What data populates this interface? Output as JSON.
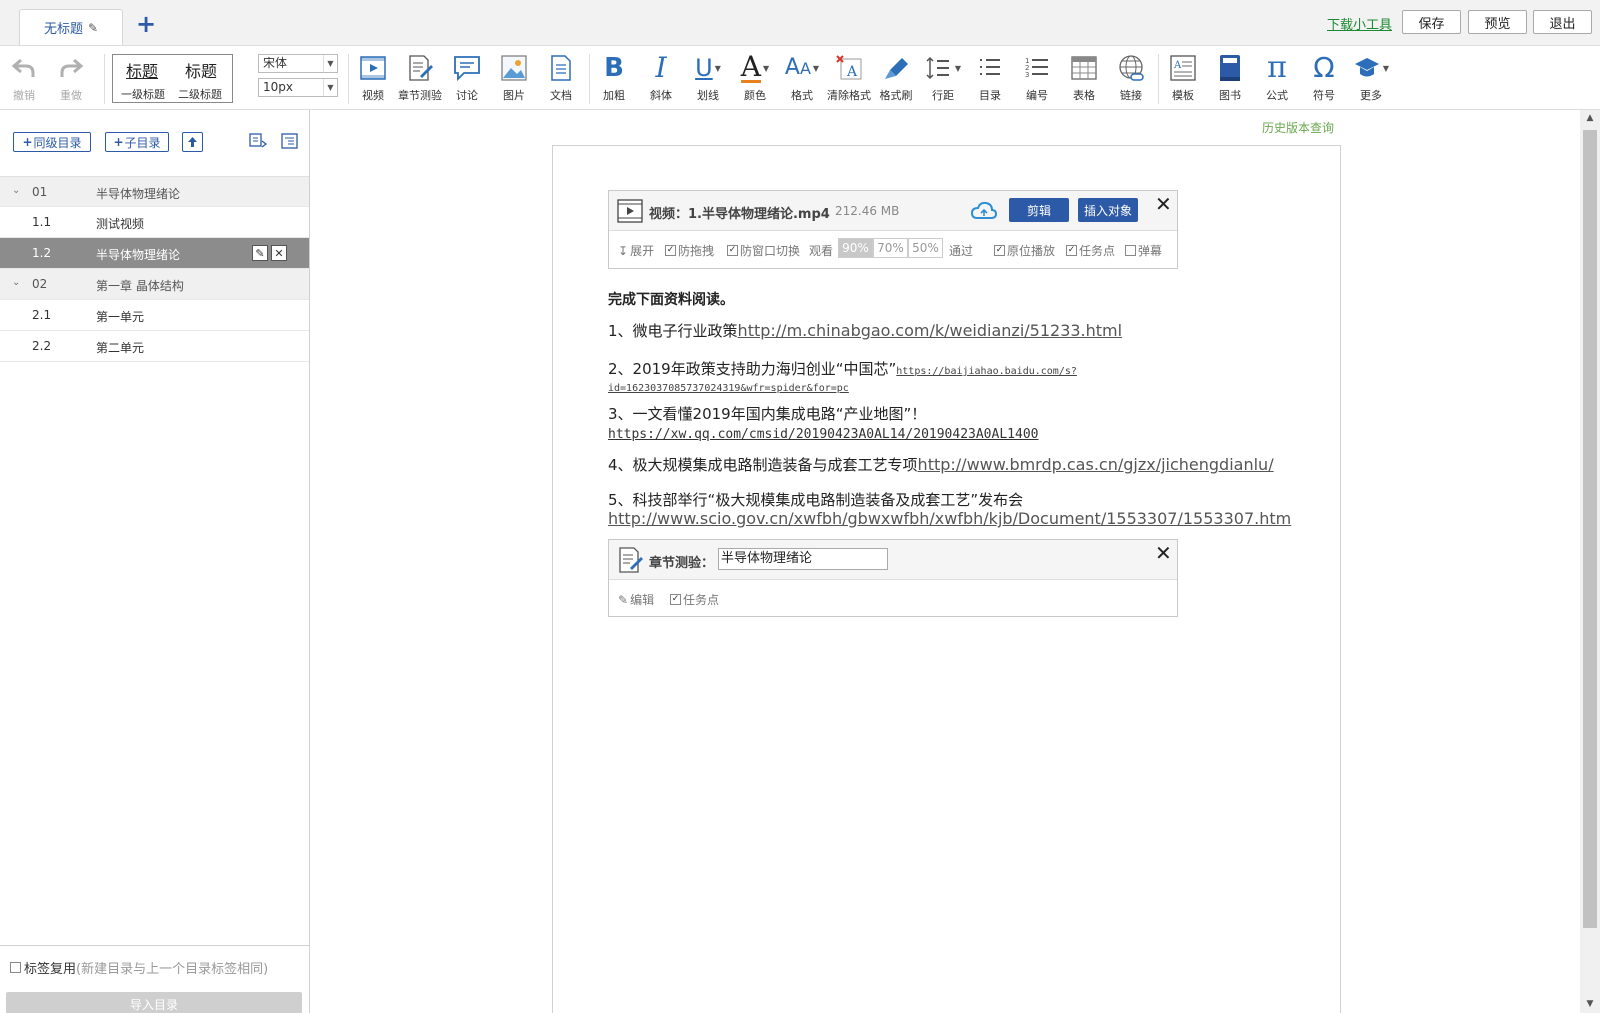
{
  "top": {
    "tab_title": "无标题",
    "add_tab": "+",
    "tools_link": "下载小工具",
    "save": "保存",
    "preview": "预览",
    "exit": "退出"
  },
  "toolbar": {
    "undo": "撤销",
    "redo": "重做",
    "heading1_big": "标题",
    "heading2_big": "标题",
    "heading1": "一级标题",
    "heading2": "二级标题",
    "font": "宋体",
    "font_size": "10px",
    "video": "视频",
    "quiz": "章节测验",
    "discuss": "讨论",
    "image": "图片",
    "doc": "文档",
    "bold": "加粗",
    "italic": "斜体",
    "underline": "划线",
    "color": "颜色",
    "format": "格式",
    "clear_format": "清除格式",
    "format_painter": "格式刷",
    "line_spacing": "行距",
    "toc": "目录",
    "numbering": "编号",
    "table": "表格",
    "link": "链接",
    "template": "模板",
    "book": "图书",
    "formula": "公式",
    "symbol": "符号",
    "more": "更多"
  },
  "sidebar": {
    "sibling_btn": "同级目录",
    "child_btn": "子目录",
    "rows": [
      {
        "num": "01",
        "title": "半导体物理绪论"
      },
      {
        "num": "1.1",
        "title": "测试视频"
      },
      {
        "num": "1.2",
        "title": "半导体物理绪论"
      },
      {
        "num": "02",
        "title": "第一章 晶体结构"
      },
      {
        "num": "2.1",
        "title": "第一单元"
      },
      {
        "num": "2.2",
        "title": "第二单元"
      }
    ],
    "reuse_label": "标签复用",
    "reuse_hint": "(新建目录与上一个目录标签相同)",
    "import_btn": "导入目录"
  },
  "main": {
    "history_link": "历史版本查询",
    "video_card": {
      "title": "视频：1.半导体物理绪论.mp4",
      "size": "212.46 MB",
      "edit_btn": "剪辑",
      "insert_btn": "插入对象",
      "expand": "展开",
      "anti_drag": "防拖拽",
      "anti_switch": "防窗口切换",
      "watch": "观看",
      "pct": [
        "90%",
        "70%",
        "50%"
      ],
      "pass": "通过",
      "inplace": "原位播放",
      "task": "任务点",
      "bullet": "弹幕"
    },
    "intro": "完成下面资料阅读。",
    "items": [
      {
        "text": "1、微电子行业政策",
        "link": "http://m.chinabgao.com/k/weidianzi/51233.html"
      },
      {
        "text": "2、2019年政策支持助力海归创业“中国芯”",
        "link": "https://baijiahao.baidu.com/s?",
        "link2": "id=1623037085737024319&wfr=spider&for=pc"
      },
      {
        "text": "3、一文看懂2019年国内集成电路“产业地图”！",
        "link": "https://xw.qq.com/cmsid/20190423A0AL14/20190423A0AL1400"
      },
      {
        "text": "4、极大规模集成电路制造装备与成套工艺专项",
        "link": "http://www.bmrdp.cas.cn/gjzx/jichengdianlu/"
      },
      {
        "text": "5、科技部举行“极大规模集成电路制造装备及成套工艺”发布会",
        "link": "http://www.scio.gov.cn/xwfbh/gbwxwfbh/xwfbh/kjb/Document/1553307/1553307.htm"
      }
    ],
    "quiz_card": {
      "label": "章节测验：",
      "value": "半导体物理绪论",
      "edit": "编辑",
      "task": "任务点"
    }
  },
  "colors": {
    "accent": "#2d5aa6",
    "green": "#1a8a33",
    "selected_row": "#8c8c8c",
    "history": "#6aa84f"
  }
}
